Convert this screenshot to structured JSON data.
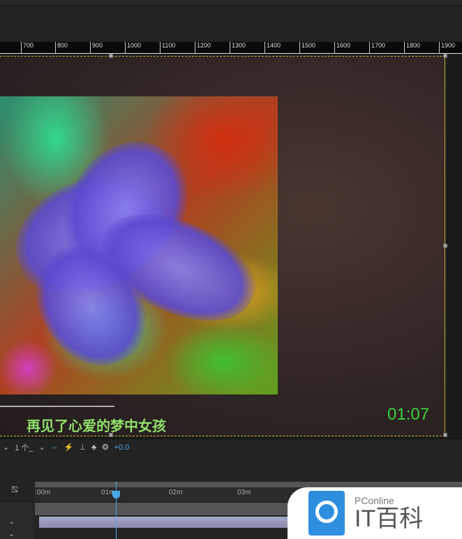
{
  "ruler": {
    "ticks": [
      "700",
      "800",
      "900",
      "1000",
      "1100",
      "1200",
      "1300",
      "1400",
      "1500",
      "1600",
      "1700",
      "1800",
      "1900"
    ]
  },
  "composition": {
    "subtitle": "再见了心爱的梦中女孩",
    "timecode": "01:07"
  },
  "toolbar": {
    "resolution": "1 个_",
    "exposure": "+0.0"
  },
  "timeline": {
    "ticks": [
      ":00m",
      "01m",
      "02m",
      "03m"
    ],
    "playhead": "01:07"
  },
  "watermark": {
    "brand": "PConline",
    "name": "IT百科"
  },
  "colors": {
    "accent": "#4aa8e8",
    "subtitle": "#8fe06a",
    "timecode": "#3ad23a"
  }
}
